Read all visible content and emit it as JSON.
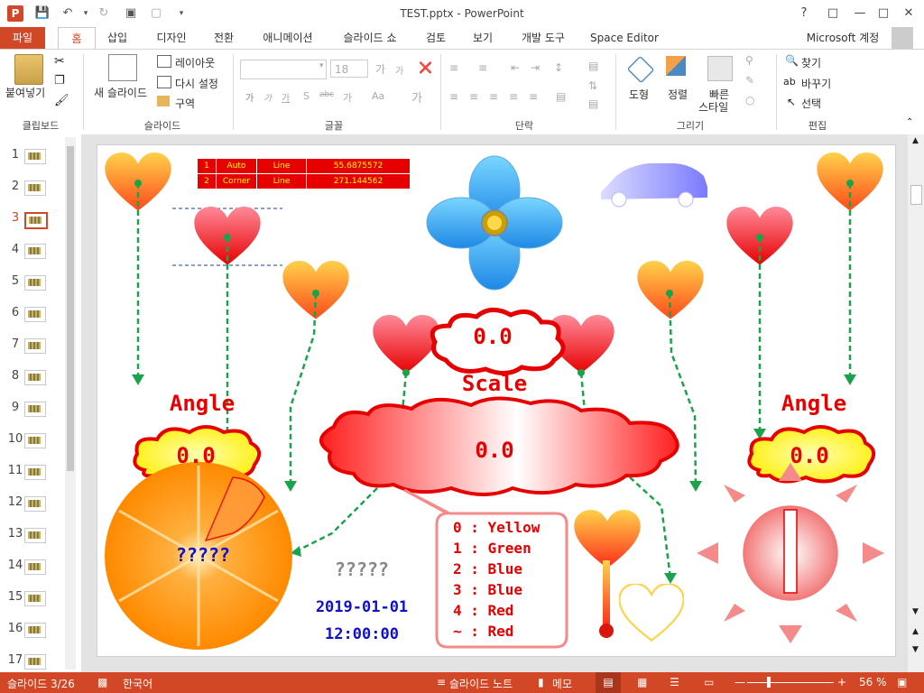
{
  "window": {
    "title": "TEST.pptx - PowerPoint",
    "help": "?",
    "account": "Microsoft 계정"
  },
  "tabs": [
    "파일",
    "홈",
    "삽입",
    "디자인",
    "전환",
    "애니메이션",
    "슬라이드 쇼",
    "검토",
    "보기",
    "개발 도구",
    "Space Editor"
  ],
  "ribbon": {
    "clipboard": {
      "label": "클립보드",
      "paste": "붙여넣기"
    },
    "slides": {
      "label": "슬라이드",
      "new_slide": "새 슬라이드",
      "layout": "레이아웃",
      "reset": "다시 설정",
      "section": "구역"
    },
    "font": {
      "label": "글꼴",
      "size": "18"
    },
    "paragraph": {
      "label": "단락"
    },
    "drawing": {
      "label": "그리기",
      "shapes": "도형",
      "arrange": "정렬",
      "quick_styles_1": "빠른",
      "quick_styles_2": "스타일"
    },
    "editing": {
      "label": "편집",
      "find": "찾기",
      "replace": "바꾸기",
      "select": "선택"
    }
  },
  "thumbnails": [
    "1",
    "2",
    "3",
    "4",
    "5",
    "6",
    "7",
    "8",
    "9",
    "10",
    "11",
    "12",
    "13",
    "14",
    "15",
    "16",
    "17"
  ],
  "active_thumbnail": 2,
  "slide": {
    "table": [
      [
        "1",
        "Auto",
        "Line",
        "55.6875572"
      ],
      [
        "2",
        "Corner",
        "Line",
        "271.144562"
      ]
    ],
    "angle_left": "Angle",
    "angle_left_value": "0.0",
    "angle_right": "Angle",
    "angle_right_value": "0.0",
    "scale": "Scale",
    "scale_value": "0.0",
    "center_value": "0.0",
    "orange_text": "?????",
    "mid_text": "?????",
    "date": "2019-01-01",
    "time": "12:00:00",
    "legend": [
      "0 : Yellow",
      "1 : Green",
      "2 : Blue",
      "3 : Blue",
      "4 : Red",
      "~ : Red"
    ]
  },
  "status": {
    "slide_info": "슬라이드 3/26",
    "language": "한국어",
    "notes": "슬라이드 노트",
    "comments": "메모",
    "zoom": "56 %"
  },
  "colors": {
    "accent": "#d24726",
    "red": "#e60000",
    "green_dash": "#1aa34a",
    "blue_text": "#1010c8"
  }
}
